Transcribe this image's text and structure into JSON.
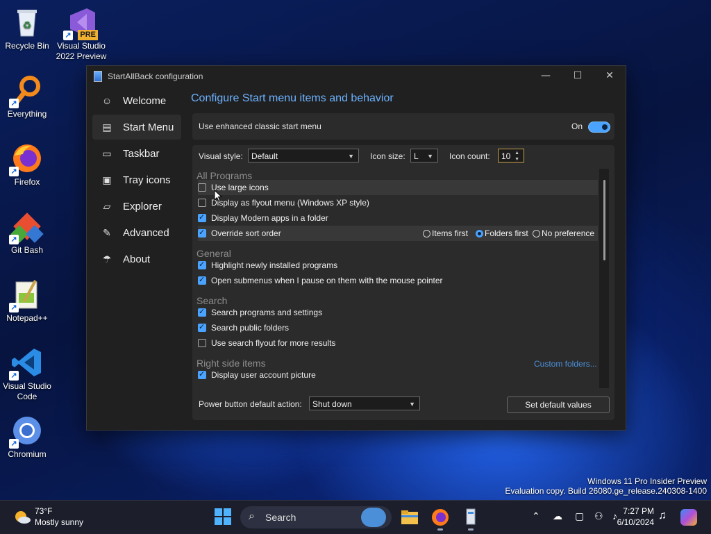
{
  "desktop": {
    "icons": [
      {
        "label": "Recycle Bin"
      },
      {
        "label": "Visual Studio 2022 Preview",
        "badge": "PRE"
      },
      {
        "label": "Everything"
      },
      {
        "label": "Firefox"
      },
      {
        "label": "Git Bash"
      },
      {
        "label": "Notepad++"
      },
      {
        "label": "Visual Studio Code"
      },
      {
        "label": "Chromium"
      }
    ]
  },
  "window": {
    "title": "StartAllBack configuration",
    "controls": {
      "minimize": "—",
      "maximize": "☐",
      "close": "✕"
    }
  },
  "sidebar": {
    "items": [
      {
        "label": "Welcome",
        "icon": "smiley-icon"
      },
      {
        "label": "Start Menu",
        "icon": "start-menu-icon"
      },
      {
        "label": "Taskbar",
        "icon": "taskbar-icon"
      },
      {
        "label": "Tray icons",
        "icon": "tray-icon"
      },
      {
        "label": "Explorer",
        "icon": "folder-icon"
      },
      {
        "label": "Advanced",
        "icon": "wrench-icon"
      },
      {
        "label": "About",
        "icon": "umbrella-icon"
      }
    ],
    "active": "Start Menu"
  },
  "main": {
    "heading": "Configure Start menu items and behavior",
    "enhanced": {
      "label": "Use enhanced classic start menu",
      "state": "On"
    },
    "visual_style": {
      "label": "Visual style:",
      "value": "Default"
    },
    "icon_size": {
      "label": "Icon size:",
      "value": "L"
    },
    "icon_count": {
      "label": "Icon count:",
      "value": "10"
    },
    "sections": {
      "all_programs": "All Programs",
      "general": "General",
      "search": "Search",
      "right_side": "Right side items"
    },
    "options": {
      "large_icons": "Use large icons",
      "flyout": "Display as flyout menu (Windows XP style)",
      "modern_apps": "Display Modern apps in a folder",
      "override_sort": "Override sort order",
      "highlight_new": "Highlight newly installed programs",
      "open_submenus": "Open submenus when I pause on them with the mouse pointer",
      "search_programs": "Search programs and settings",
      "search_public": "Search public folders",
      "search_flyout": "Use search flyout for more results",
      "user_picture": "Display user account picture"
    },
    "sort_options": {
      "items_first": "Items first",
      "folders_first": "Folders first",
      "no_pref": "No preference"
    },
    "custom_folders": "Custom folders...",
    "power": {
      "label": "Power button default action:",
      "value": "Shut down"
    },
    "default_button": "Set default values"
  },
  "watermark": {
    "line1": "Windows 11 Pro Insider Preview",
    "line2": "Evaluation copy. Build 26080.ge_release.240308-1400"
  },
  "taskbar": {
    "weather": {
      "temp": "73°F",
      "desc": "Mostly sunny"
    },
    "search_placeholder": "Search",
    "time": "7:27 PM",
    "date": "6/10/2024"
  },
  "colors": {
    "accent": "#4aa3ff",
    "heading": "#6cb2ff"
  }
}
